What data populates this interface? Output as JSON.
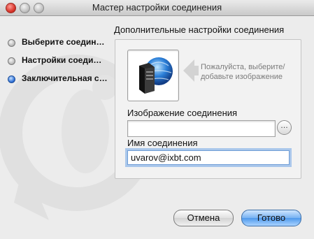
{
  "window": {
    "title": "Мастер настройки соединения"
  },
  "sidebar": {
    "steps": [
      {
        "label": "Выберите соедин…",
        "active": false
      },
      {
        "label": "Настройки соеди…",
        "active": false
      },
      {
        "label": "Заключительная с…",
        "active": true
      }
    ]
  },
  "main": {
    "heading": "Дополнительные настройки соединения",
    "image_hint": "Пожалуйста, выберите/добавьте изображение",
    "image_field": {
      "label": "Изображение соединения",
      "value": "",
      "browse_label": "…"
    },
    "name_field": {
      "label": "Имя соединения",
      "value": "uvarov@ixbt.com"
    }
  },
  "buttons": {
    "cancel": "Отмена",
    "done": "Готово"
  },
  "colors": {
    "accent": "#4f99ec",
    "focus_ring": "#6fa4e6"
  }
}
